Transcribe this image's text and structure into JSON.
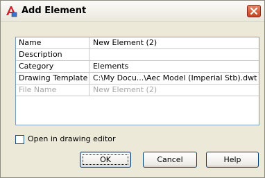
{
  "window": {
    "title": "Add Element"
  },
  "properties": [
    {
      "key": "Name",
      "value": "New Element (2)",
      "disabled": false
    },
    {
      "key": "Description",
      "value": "",
      "disabled": false
    },
    {
      "key": "Category",
      "value": "Elements",
      "disabled": false
    },
    {
      "key": "Drawing Template",
      "value": "C:\\My Docu...\\Aec Model (Imperial Stb).dwt",
      "disabled": false
    },
    {
      "key": "File Name",
      "value": "New Element (2)",
      "disabled": true
    }
  ],
  "open_in_editor": {
    "label": "Open in drawing editor",
    "checked": false
  },
  "buttons": {
    "ok": "OK",
    "cancel": "Cancel",
    "help": "Help"
  },
  "icons": {
    "app": "autocad-a-icon",
    "close": "close-icon"
  },
  "colors": {
    "close_button": "#c8431f",
    "app_icon": "#d4212b",
    "table_border": "#7f9db9"
  }
}
